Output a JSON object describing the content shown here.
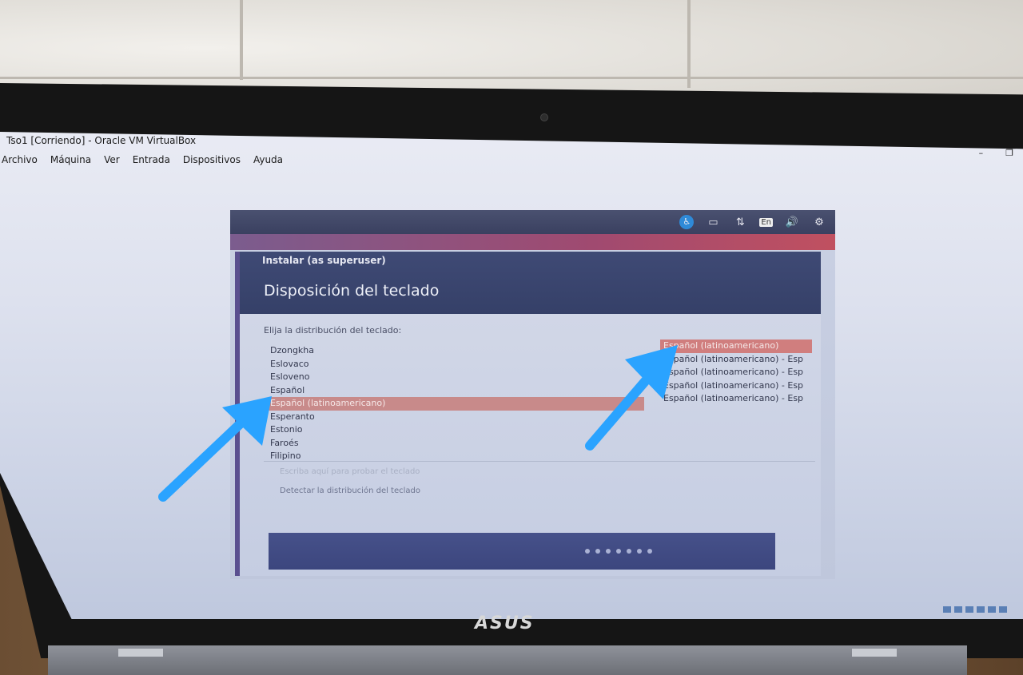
{
  "virtualbox": {
    "window_title": "Tso1 [Corriendo] - Oracle VM VirtualBox",
    "menu": [
      "Archivo",
      "Máquina",
      "Ver",
      "Entrada",
      "Dispositivos",
      "Ayuda"
    ]
  },
  "vm_topbar": {
    "icons": [
      "accessibility-icon",
      "battery-icon",
      "network-icon",
      "keyboard-layout-indicator",
      "volume-icon",
      "settings-gear-icon"
    ],
    "keyboard_indicator": "En"
  },
  "installer": {
    "subtitle": "Instalar (as superuser)",
    "title": "Disposición del teclado",
    "prompt": "Elija la distribución del teclado:",
    "layouts": [
      "Dzongkha",
      "Eslovaco",
      "Esloveno",
      "Español",
      "Español (latinoamericano)",
      "Esperanto",
      "Estonio",
      "Faroés",
      "Filipino"
    ],
    "selected_layout": "Español (latinoamericano)",
    "variants": [
      "Español (latinoamericano)",
      "Español (latinoamericano) - Esp",
      "Español (latinoamericano) - Esp",
      "Español (latinoamericano) - Esp",
      "Español (latinoamericano) - Esp"
    ],
    "selected_variant": "Español (latinoamericano)",
    "test_placeholder": "Escriba aquí para probar el teclado",
    "detect_button": "Detectar la distribución del teclado",
    "progress_steps": 7
  },
  "laptop": {
    "brand": "ASUS"
  },
  "colors": {
    "selection": "#c88a8a",
    "header": "#3f4a75",
    "arrow": "#2aa3ff"
  }
}
